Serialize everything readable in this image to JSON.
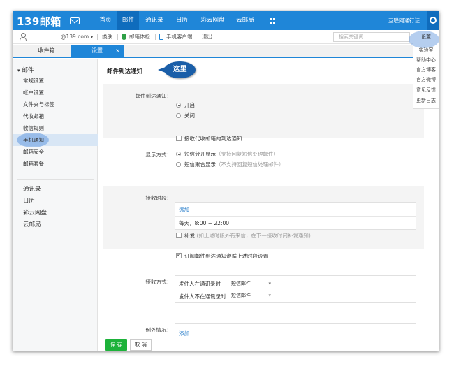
{
  "topnav": {
    "logo": "139邮箱",
    "tabs": [
      "首页",
      "邮件",
      "通讯录",
      "日历",
      "彩云网盘",
      "云邮局"
    ],
    "active_tab": "邮件",
    "passport": "互联网通行证"
  },
  "userbar": {
    "account": "@139.com",
    "skin": "换肤",
    "mailbox_check": "邮箱体检",
    "mobile_client": "手机客户端",
    "logout": "退出",
    "search_placeholder": "搜索关键词"
  },
  "tabs": {
    "inbox": "收件箱",
    "settings": "设置",
    "close": "×"
  },
  "settings_menu": [
    "设置",
    "实验室",
    "帮助中心",
    "官方博客",
    "官方微博",
    "意见反馈",
    "更新日志"
  ],
  "sidebar": {
    "group": "邮件",
    "items": [
      "常规设置",
      "帐户设置",
      "文件夹与标签",
      "代收邮箱",
      "收信规则",
      "手机通知",
      "邮箱安全",
      "邮箱套餐"
    ],
    "active_item": "手机通知",
    "apps": [
      "通讯录",
      "日历",
      "彩云网盘",
      "云邮局"
    ]
  },
  "main": {
    "title": "邮件到达通知",
    "callout": "这里",
    "arrival": {
      "label": "邮件到达通知：",
      "on": "开启",
      "off": "关闭",
      "selected": "开启"
    },
    "receive_collected": "接收代收邮箱的到达通知",
    "display": {
      "label": "显示方式：",
      "opt1": "短信分开显示",
      "opt1_hint": "（支持回复短信处理邮件）",
      "opt2": "短信聚合显示",
      "opt2_hint": "（不支持回复短信处理邮件）",
      "selected": "短信分开显示"
    },
    "period": {
      "label": "接收时段：",
      "add": "添加",
      "value": "每天，8:00 ~ 22:00",
      "resend": "补发",
      "resend_hint": "(如上述时段外有来信，在下一接收时间补发通知)"
    },
    "subscribe": "订阅邮件到达通知遵循上述时段设置",
    "method": {
      "label": "接收方式：",
      "row1_label": "发件人在通讯录时",
      "row1_value": "短信邮件",
      "row2_label": "发件人不在通讯录时",
      "row2_value": "短信邮件"
    },
    "exception": {
      "label": "例外情况：",
      "add": "添加"
    },
    "save": "保 存",
    "cancel": "取 消"
  }
}
